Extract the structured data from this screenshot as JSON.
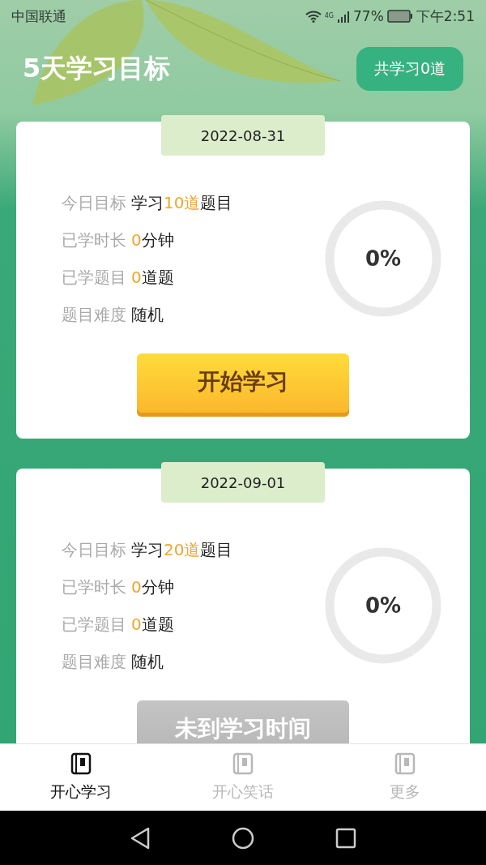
{
  "status_bar": {
    "carrier": "中国联通",
    "network": "4G",
    "battery": "77%",
    "time": "下午2:51"
  },
  "header": {
    "title": "5天学习目标",
    "total_badge": "共学习0道"
  },
  "cards": [
    {
      "date": "2022-08-31",
      "rows": [
        {
          "label": "今日目标",
          "parts": [
            {
              "text": "学习",
              "highlight": false
            },
            {
              "text": "10道",
              "highlight": true
            },
            {
              "text": "题目",
              "highlight": false
            }
          ]
        },
        {
          "label": "已学时长",
          "parts": [
            {
              "text": "0",
              "highlight": true
            },
            {
              "text": "分钟",
              "highlight": false
            }
          ]
        },
        {
          "label": "已学题目",
          "parts": [
            {
              "text": "0",
              "highlight": true
            },
            {
              "text": "道题",
              "highlight": false
            }
          ]
        },
        {
          "label": "题目难度",
          "parts": [
            {
              "text": "随机",
              "highlight": false
            }
          ]
        }
      ],
      "progress": {
        "level": 0,
        "reading": "0%"
      },
      "button": {
        "label": "开始学习",
        "disabled": false
      }
    },
    {
      "date": "2022-09-01",
      "rows": [
        {
          "label": "今日目标",
          "parts": [
            {
              "text": "学习",
              "highlight": false
            },
            {
              "text": "20道",
              "highlight": true
            },
            {
              "text": "题目",
              "highlight": false
            }
          ]
        },
        {
          "label": "已学时长",
          "parts": [
            {
              "text": "0",
              "highlight": true
            },
            {
              "text": "分钟",
              "highlight": false
            }
          ]
        },
        {
          "label": "已学题目",
          "parts": [
            {
              "text": "0",
              "highlight": true
            },
            {
              "text": "道题",
              "highlight": false
            }
          ]
        },
        {
          "label": "题目难度",
          "parts": [
            {
              "text": "随机",
              "highlight": false
            }
          ]
        }
      ],
      "progress": {
        "level": 0,
        "reading": "0%"
      },
      "button": {
        "label": "未到学习时间",
        "disabled": true
      }
    }
  ],
  "tabs": [
    {
      "label": "开心学习",
      "selected": true
    },
    {
      "label": "开心笑话",
      "selected": false
    },
    {
      "label": "更多",
      "selected": false
    }
  ]
}
